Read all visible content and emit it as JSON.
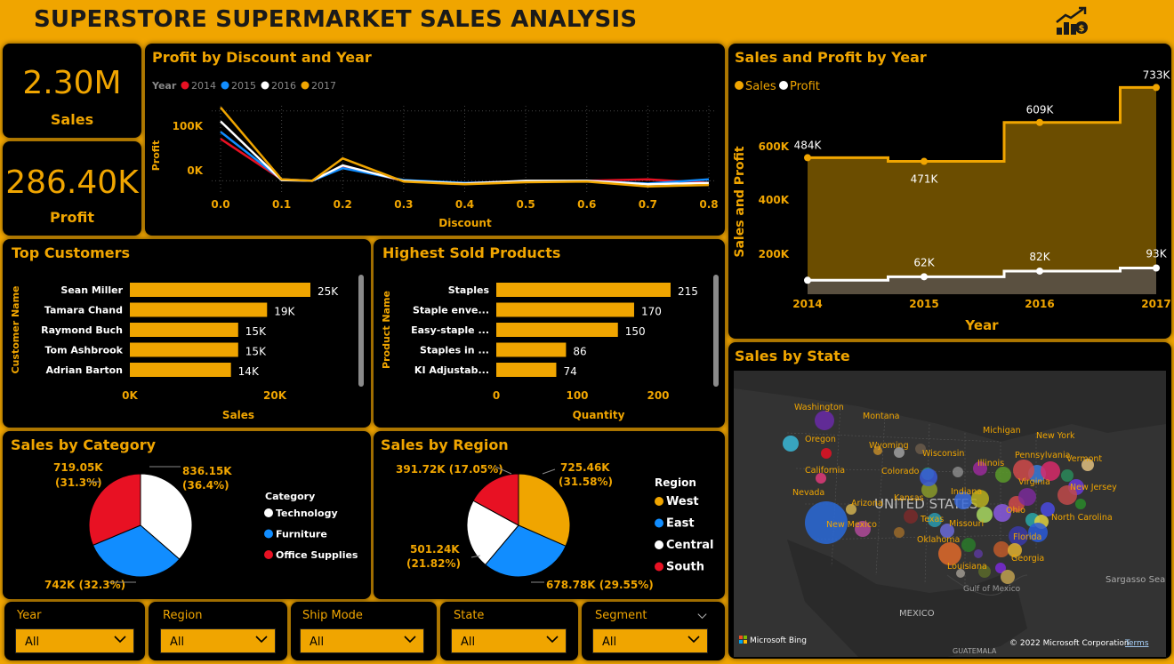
{
  "header": {
    "title": "SUPERSTORE SUPERMARKET SALES ANALYSIS",
    "logo_icon": "money-growth-icon",
    "colors": {
      "accent": "#f0a500",
      "panel": "#000000"
    }
  },
  "kpis": {
    "sales": {
      "value": "2.30M",
      "label": "Sales"
    },
    "profit": {
      "value": "286.40K",
      "label": "Profit"
    }
  },
  "profit_discount": {
    "title": "Profit by Discount and Year",
    "legend_title": "Year",
    "x_label": "Discount",
    "y_label": "Profit",
    "y_ticks": [
      "100K",
      "0K"
    ],
    "x_ticks": [
      "0.0",
      "0.1",
      "0.2",
      "0.3",
      "0.4",
      "0.5",
      "0.6",
      "0.7",
      "0.8"
    ]
  },
  "sales_profit_year": {
    "title": "Sales and Profit by Year",
    "x_label": "Year",
    "y_label": "Sales and Profit",
    "y_ticks": [
      "600K",
      "400K",
      "200K"
    ],
    "sales_labels": [
      "484K",
      "471K",
      "609K",
      "733K"
    ],
    "profit_labels": [
      "62K",
      "82K",
      "93K"
    ]
  },
  "top_customers": {
    "title": "Top Customers",
    "x_label": "Sales",
    "y_label": "Customer Name",
    "x_ticks": [
      "0K",
      "20K"
    ]
  },
  "products": {
    "title": "Highest Sold Products",
    "x_label": "Quantity",
    "y_label": "Product Name",
    "x_ticks": [
      "0",
      "100",
      "200"
    ]
  },
  "category": {
    "title": "Sales by Category",
    "legend_title": "Category",
    "labels": [
      "836.15K",
      "(36.4%)",
      "719.05K",
      "(31.3%)",
      "742K (32.3%)"
    ]
  },
  "region": {
    "title": "Sales by Region",
    "legend_title": "Region",
    "labels": [
      "391.72K (17.05%)",
      "725.46K",
      "(31.58%)",
      "501.24K",
      "(21.82%)",
      "678.78K (29.55%)"
    ]
  },
  "state_map": {
    "title": "Sales by State",
    "country_label": "UNITED STATES",
    "mexico": "MEXICO",
    "gulf": "Gulf of Mexico",
    "sea": "Sargasso Sea",
    "guatemala": "GUATEMALA",
    "bing": "Microsoft Bing",
    "copyright": "© 2022 Microsoft Corporation",
    "terms": "Terms",
    "states": [
      {
        "name": "Washington"
      },
      {
        "name": "Montana"
      },
      {
        "name": "Oregon"
      },
      {
        "name": "Wyoming"
      },
      {
        "name": "Michigan"
      },
      {
        "name": "New York"
      },
      {
        "name": "Wisconsin"
      },
      {
        "name": "Vermont"
      },
      {
        "name": "Pennsylvania"
      },
      {
        "name": "California"
      },
      {
        "name": "Illinois"
      },
      {
        "name": "Colorado"
      },
      {
        "name": "Virginia"
      },
      {
        "name": "Nevada"
      },
      {
        "name": "Kansas"
      },
      {
        "name": "Indiana"
      },
      {
        "name": "New Jersey"
      },
      {
        "name": "Arizona"
      },
      {
        "name": "Ohio"
      },
      {
        "name": "North Carolina"
      },
      {
        "name": "Texas"
      },
      {
        "name": "Missouri"
      },
      {
        "name": "New Mexico"
      },
      {
        "name": "Florida"
      },
      {
        "name": "Oklahoma"
      },
      {
        "name": "Louisiana"
      },
      {
        "name": "Georgia"
      }
    ]
  },
  "slicers": {
    "year": {
      "label": "Year",
      "value": "All"
    },
    "region": {
      "label": "Region",
      "value": "All"
    },
    "ship_mode": {
      "label": "Ship Mode",
      "value": "All"
    },
    "state": {
      "label": "State",
      "value": "All"
    },
    "segment": {
      "label": "Segment",
      "value": "All"
    }
  },
  "chart_data": [
    {
      "type": "line",
      "title": "Profit by Discount and Year",
      "xlabel": "Discount",
      "ylabel": "Profit",
      "x": [
        0.0,
        0.1,
        0.15,
        0.2,
        0.3,
        0.4,
        0.5,
        0.6,
        0.7,
        0.8
      ],
      "ylim": [
        -30000,
        120000
      ],
      "series": [
        {
          "name": "2014",
          "color": "#e81123",
          "values": [
            60000,
            2000,
            0,
            20000,
            0,
            -3000,
            -1000,
            0,
            2000,
            -3000
          ]
        },
        {
          "name": "2015",
          "color": "#118dff",
          "values": [
            70000,
            2000,
            0,
            18000,
            1000,
            -3000,
            -1000,
            0,
            -4000,
            2000
          ]
        },
        {
          "name": "2016",
          "color": "#ffffff",
          "values": [
            85000,
            1000,
            0,
            22000,
            0,
            -4000,
            0,
            0,
            -5000,
            -3000
          ]
        },
        {
          "name": "2017",
          "color": "#f0a500",
          "values": [
            105000,
            2000,
            0,
            32000,
            -1000,
            -5000,
            -2000,
            -1000,
            -8000,
            -6000
          ]
        }
      ]
    },
    {
      "type": "area",
      "title": "Sales and Profit by Year",
      "xlabel": "Year",
      "ylabel": "Sales and Profit",
      "categories": [
        "2014",
        "2015",
        "2016",
        "2017"
      ],
      "ylim": [
        0,
        750000
      ],
      "series": [
        {
          "name": "Sales",
          "color": "#f0a500",
          "values": [
            484000,
            471000,
            609000,
            733000
          ]
        },
        {
          "name": "Profit",
          "color": "#ffffff",
          "values": [
            49500,
            62000,
            82000,
            93000
          ]
        }
      ]
    },
    {
      "type": "bar",
      "title": "Top Customers",
      "xlabel": "Sales",
      "ylabel": "Customer Name",
      "categories": [
        "Sean Miller",
        "Tamara Chand",
        "Raymond Buch",
        "Tom Ashbrook",
        "Adrian Barton"
      ],
      "values": [
        25000,
        19000,
        15000,
        15000,
        14000
      ],
      "data_labels": [
        "25K",
        "19K",
        "15K",
        "15K",
        "14K"
      ],
      "xlim": [
        0,
        28000
      ]
    },
    {
      "type": "bar",
      "title": "Highest Sold Products",
      "xlabel": "Quantity",
      "ylabel": "Product Name",
      "categories": [
        "Staples",
        "Staple enve...",
        "Easy-staple ...",
        "Staples in ...",
        "KI Adjustab..."
      ],
      "values": [
        215,
        170,
        150,
        86,
        74
      ],
      "xlim": [
        0,
        230
      ]
    },
    {
      "type": "pie",
      "title": "Sales by Category",
      "categories": [
        "Technology",
        "Furniture",
        "Office Supplies"
      ],
      "values": [
        836150,
        742000,
        719050
      ],
      "colors": [
        "#ffffff",
        "#118dff",
        "#e81123"
      ]
    },
    {
      "type": "pie",
      "title": "Sales by Region",
      "categories": [
        "West",
        "East",
        "Central",
        "South"
      ],
      "values": [
        725460,
        678780,
        501240,
        391720
      ],
      "colors": [
        "#f0a500",
        "#118dff",
        "#ffffff",
        "#e81123"
      ]
    }
  ]
}
